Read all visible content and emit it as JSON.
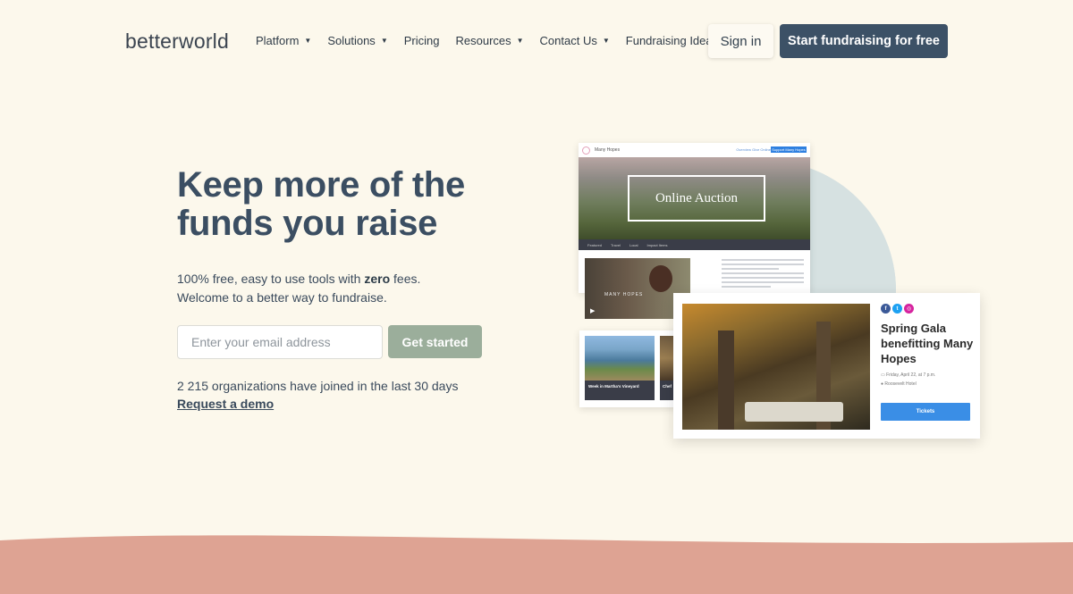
{
  "nav": {
    "logo": "betterworld",
    "items": [
      {
        "label": "Platform",
        "dropdown": true
      },
      {
        "label": "Solutions",
        "dropdown": true
      },
      {
        "label": "Pricing",
        "dropdown": false
      },
      {
        "label": "Resources",
        "dropdown": true
      },
      {
        "label": "Contact Us",
        "dropdown": true
      },
      {
        "label": "Fundraising Ideas",
        "dropdown": false
      }
    ],
    "signin": "Sign in",
    "start": "Start fundraising for free"
  },
  "hero": {
    "headline": "Keep more of the funds you raise",
    "sub_line1_pre": "100% free, easy to use tools with ",
    "sub_line1_bold": "zero",
    "sub_line1_post": " fees.",
    "sub_line2": "Welcome to a better way to fundraise.",
    "email_placeholder": "Enter your email address",
    "cta": "Get started",
    "joined": "2 215 organizations have joined in the last 30 days",
    "demo": "Request a demo"
  },
  "mockup": {
    "org_name": "Many Hopes",
    "top_links": "Overview   Give Online",
    "top_button": "Support Many Hopes",
    "banner_title": "Online Auction",
    "tabs": [
      "Featured",
      "Travel",
      "Local",
      "Impact Items"
    ],
    "video_caption": "MANY HOPES",
    "card1_caption": "Week in Martha's Vineyard",
    "card2_caption": "Chef",
    "event_title": "Spring Gala benefitting Many Hopes",
    "event_date": "Friday, April 22, at 7 p.m.",
    "event_place": "Roosevelt Hotel",
    "tickets": "Tickets"
  },
  "colors": {
    "background": "#fcf8ec",
    "primary": "#3c5166",
    "cta_green": "#9bae9b",
    "wave": "#dea393",
    "tickets_blue": "#3a8ee6"
  }
}
